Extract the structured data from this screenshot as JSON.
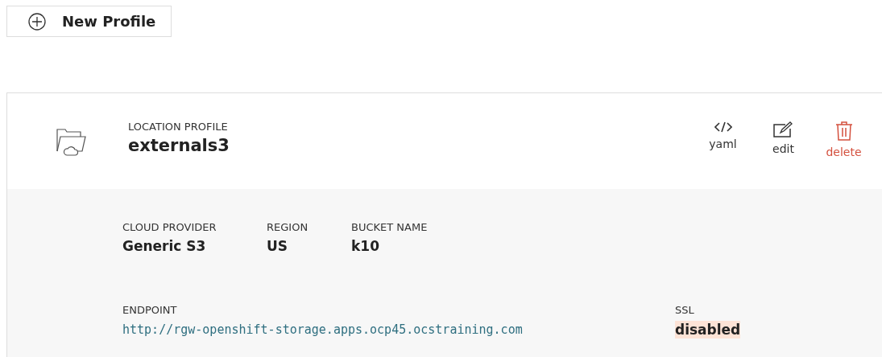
{
  "new_button": {
    "label": "New Profile"
  },
  "profile": {
    "type_label": "LOCATION PROFILE",
    "name": "externals3",
    "actions": [
      {
        "kind": "yaml",
        "label": "yaml"
      },
      {
        "kind": "edit",
        "label": "edit"
      },
      {
        "kind": "delete",
        "label": "delete"
      }
    ],
    "fields": [
      {
        "label": "CLOUD PROVIDER",
        "value": "Generic S3",
        "kind": "text"
      },
      {
        "label": "REGION",
        "value": "US",
        "kind": "text"
      },
      {
        "label": "BUCKET NAME",
        "value": "k10",
        "kind": "text"
      },
      {
        "label": "ENDPOINT",
        "value": "http://rgw-openshift-storage.apps.ocp45.ocstraining.com",
        "kind": "mono"
      },
      {
        "label": "SSL",
        "value": "disabled",
        "kind": "badge"
      }
    ]
  }
}
